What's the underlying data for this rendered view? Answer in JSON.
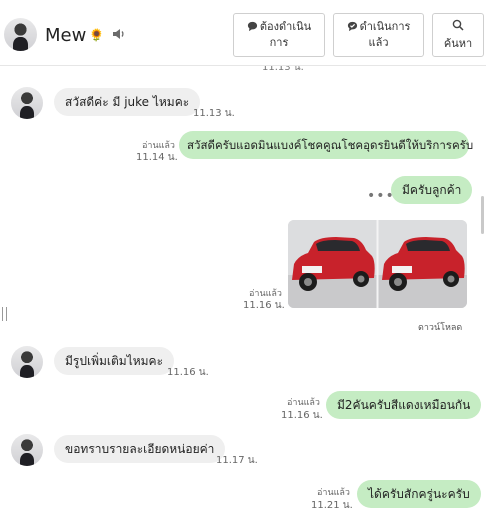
{
  "header": {
    "contact_name": "Mew",
    "name_emoji": "🌻",
    "buttons": {
      "pending_line1": "ต้องดำเนิน",
      "pending_line2": "การ",
      "done_line1": "ดำเนินการ",
      "done_line2": "แล้ว",
      "search": "ค้นหา"
    }
  },
  "messages": {
    "top_time": "11.13 น.",
    "m1": {
      "text": "สวัสดีค่ะ มี juke ไหมคะ",
      "time": "11.13 น."
    },
    "m2": {
      "read": "อ่านแล้ว",
      "time": "11.14 น.",
      "text": "สวัสดีครับแอดมินแบงค์โชคคูณโชคอุดรยินดีให้บริการครับ"
    },
    "m3": {
      "dots": "•••",
      "text": "มีครับลูกค้า"
    },
    "m4": {
      "read": "อ่านแล้ว",
      "time": "11.16 น.",
      "download": "ดาวน์โหลด"
    },
    "m5": {
      "text": "มีรูปเพิ่มเติมไหมคะ",
      "time": "11.16 น."
    },
    "m6": {
      "read": "อ่านแล้ว",
      "time": "11.16 น.",
      "text": "มี2คันครับสีแดงเหมือนกัน"
    },
    "m7": {
      "text": "ขอทราบรายละเอียดหน่อยค่า",
      "time": "11.17 น."
    },
    "m8": {
      "read": "อ่านแล้ว",
      "time": "11.21 น.",
      "text": "ได้ครับสักครู่นะครับ"
    }
  },
  "colors": {
    "incoming_bubble": "#efefef",
    "outgoing_bubble": "#c5ecc3",
    "car_red": "#c8222b"
  }
}
